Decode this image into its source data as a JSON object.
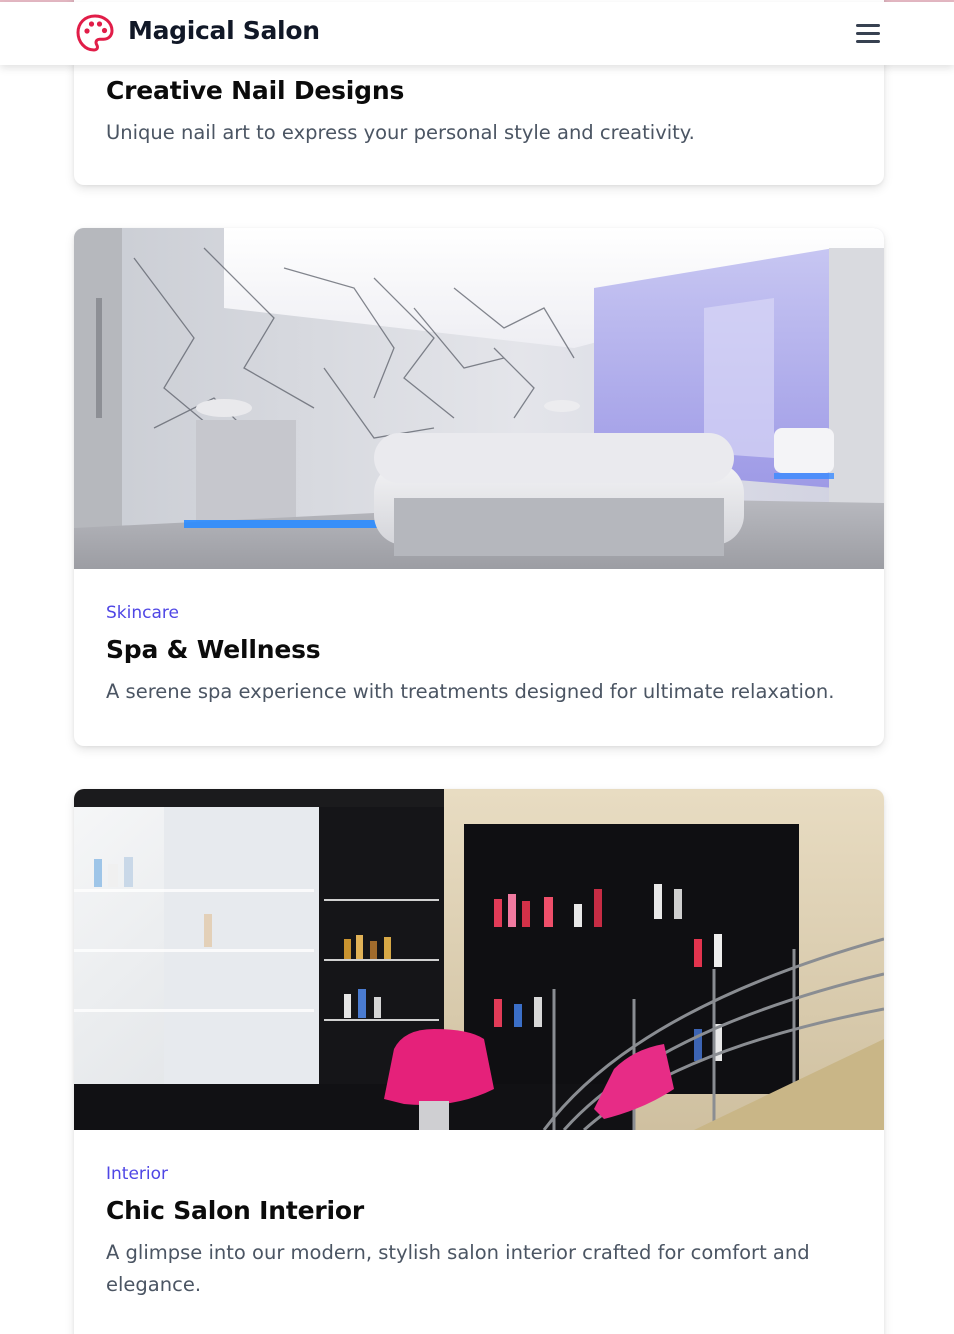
{
  "header": {
    "brand": "Magical Salon",
    "logo_icon": "palette-icon",
    "menu_icon": "hamburger-menu-icon",
    "accent_color": "#e11d48"
  },
  "cards": [
    {
      "title": "Creative Nail Designs",
      "description": "Unique nail art to express your personal style and creativity."
    },
    {
      "category": "Skincare",
      "title": "Spa & Wellness",
      "description": "A serene spa experience with treatments designed for ultimate relaxation."
    },
    {
      "category": "Interior",
      "title": "Chic Salon Interior",
      "description": "A glimpse into our modern, stylish salon interior crafted for comfort and elegance."
    }
  ],
  "colors": {
    "category_text": "#4f46e5",
    "title_text": "#0b0b0b",
    "description_text": "#4b5563"
  }
}
